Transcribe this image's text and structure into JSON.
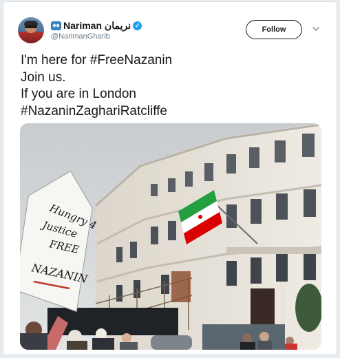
{
  "user": {
    "display_name": "Nariman نریمان",
    "handle": "@NarimanGharib",
    "avatar_icon": "avatar-photo",
    "verified_icon": "verified-badge-icon",
    "emoji_icon": "emoji-face-icon"
  },
  "actions": {
    "follow_label": "Follow",
    "more_icon": "chevron-down-icon"
  },
  "tweet": {
    "lines": [
      "I'm here for #FreeNazanin",
      "Join us.",
      "If you are in London",
      "#NazaninZaghariRatcliffe"
    ]
  },
  "photo": {
    "sign_lines": [
      "Hungry 4",
      "Justice",
      "FREE",
      "NAZANIN"
    ]
  },
  "colors": {
    "text": "#14171a",
    "secondary": "#657786",
    "verified": "#1da1f2",
    "flag_green": "#239f40",
    "flag_red": "#da0000"
  }
}
